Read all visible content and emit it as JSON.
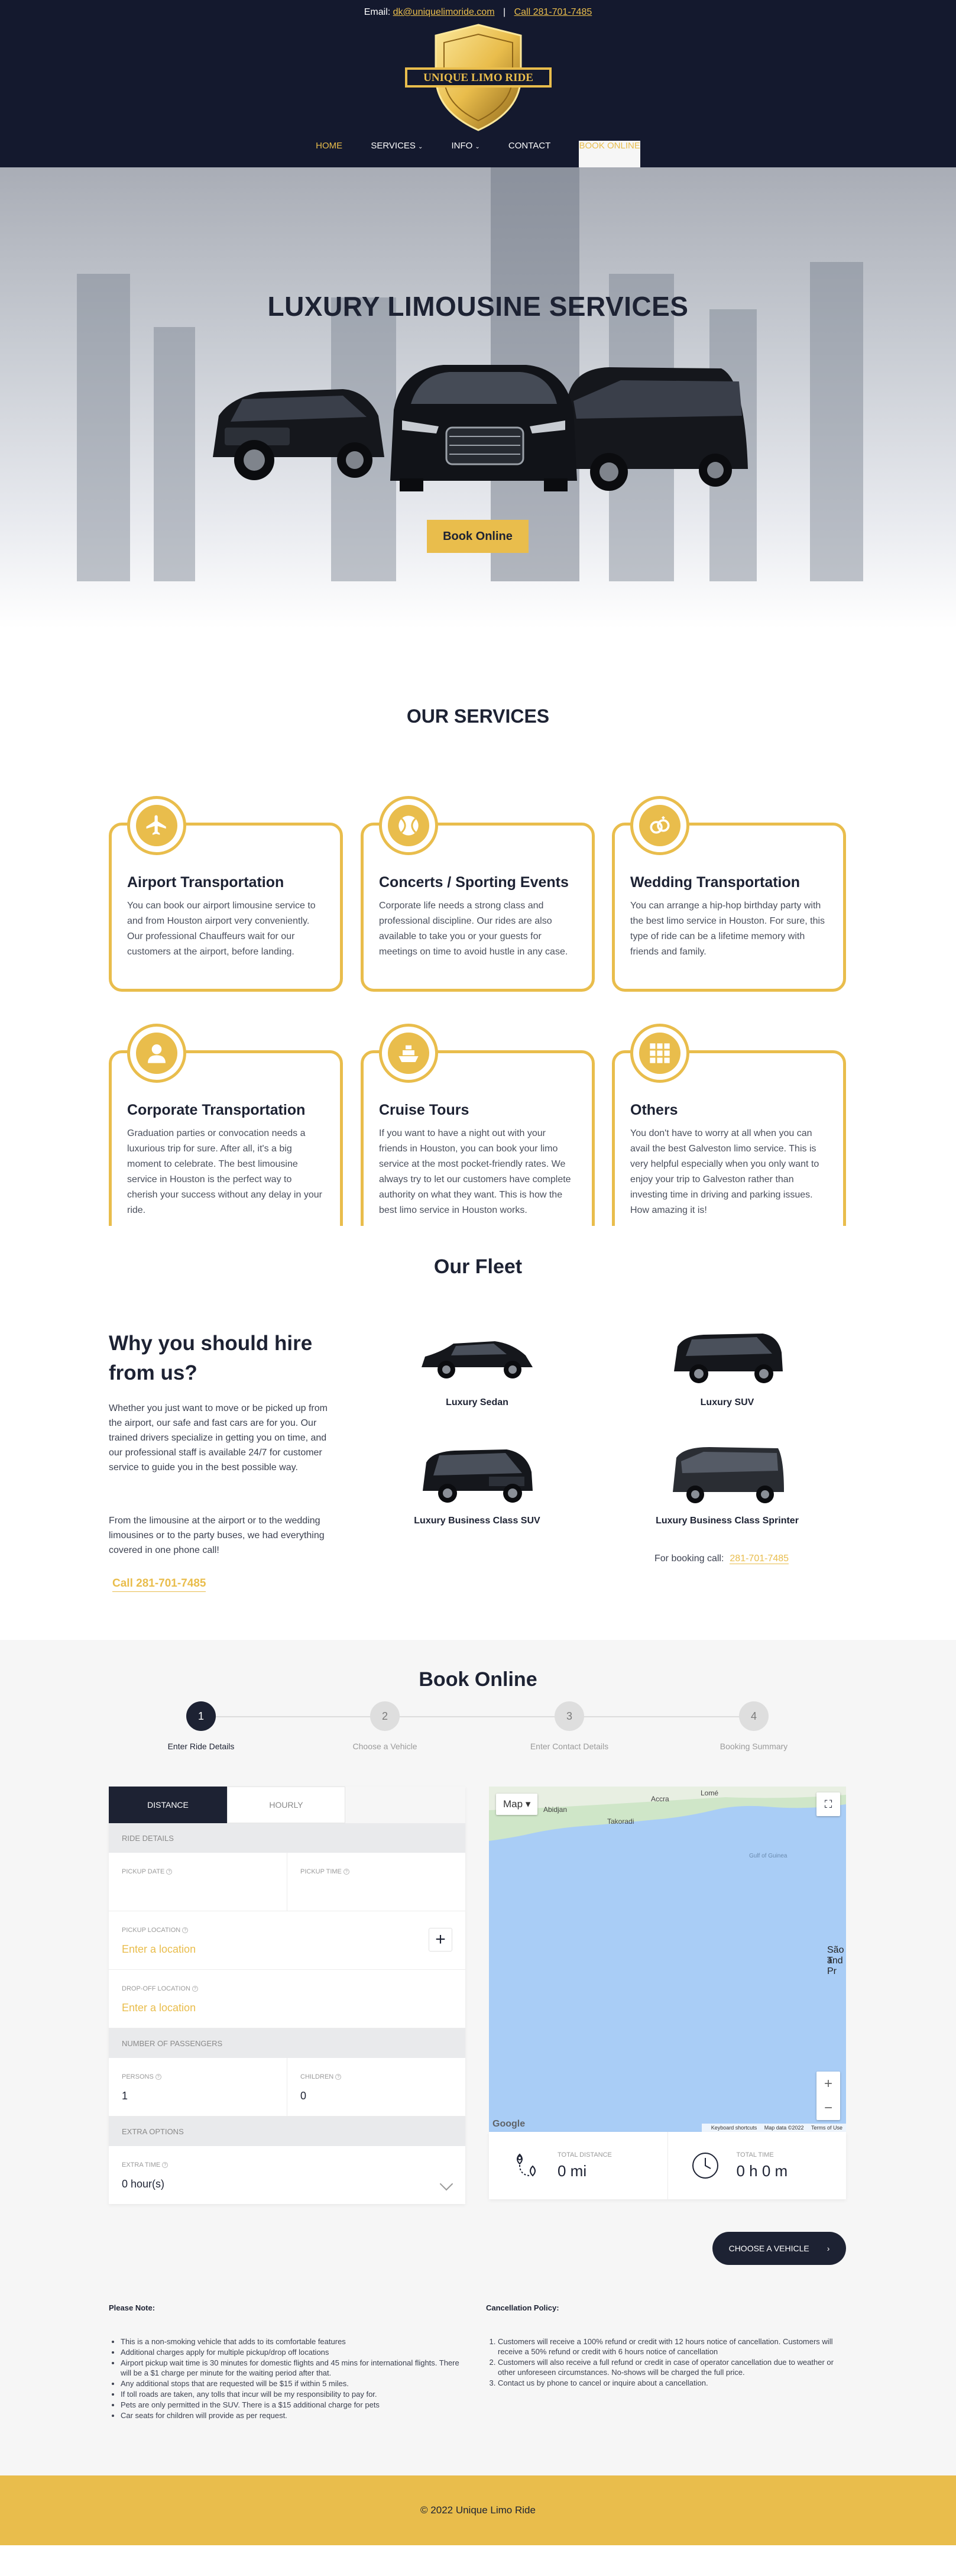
{
  "topbar": {
    "email_label": "Email:",
    "email": "dk@uniquelimoride.com",
    "separator": "|",
    "call": "Call 281-701-7485"
  },
  "logo": {
    "text": "UNIQUE LIMO RIDE"
  },
  "nav": [
    {
      "label": "HOME",
      "dropdown": false
    },
    {
      "label": "SERVICES",
      "dropdown": true
    },
    {
      "label": "INFO",
      "dropdown": true
    },
    {
      "label": "CONTACT",
      "dropdown": false
    },
    {
      "label": "BOOK ONLINE",
      "dropdown": false
    }
  ],
  "hero": {
    "title": "LUXURY LIMOUSINE SERVICES",
    "button": "Book Online"
  },
  "services": {
    "title": "OUR SERVICES",
    "items": [
      {
        "icon": "airplane-icon",
        "title": "Airport Transportation",
        "text": "You can book our airport limousine service to and from Houston airport very conveniently. Our professional Chauffeurs wait for our customers at the airport, before landing."
      },
      {
        "icon": "ball-icon",
        "title": "Concerts / Sporting Events",
        "text": "Corporate life needs a strong class and professional discipline. Our rides are also available to take you or your guests for meetings on time to avoid hustle in any case."
      },
      {
        "icon": "wedding-rings-icon",
        "title": "Wedding Transportation",
        "text": "You can arrange a hip-hop birthday party with the best limo service in Houston. For sure, this type of ride can be a lifetime memory with friends and family."
      },
      {
        "icon": "person-icon",
        "title": "Corporate Transportation",
        "text": "Graduation parties or convocation needs a luxurious trip for sure. After all, it's a big moment to celebrate. The best limousine service in Houston is the perfect way to cherish your success without any delay in your ride."
      },
      {
        "icon": "ship-icon",
        "title": "Cruise Tours",
        "text": "If you want to have a night out with your friends in Houston, you can book your limo service at the most pocket-friendly rates. We always try to let our customers have complete authority on what they want. This is how the best limo service in Houston works."
      },
      {
        "icon": "grid-icon",
        "title": "Others",
        "text": "You don't have to worry at all when you can avail the best Galveston limo service. This is very helpful especially when you only want to enjoy your trip to Galveston rather than investing time in driving and parking issues. How amazing it is!"
      }
    ]
  },
  "fleet": {
    "title": "Our Fleet",
    "why_title": "Why you should hire from us?",
    "why_p1": "Whether you just want to move or be picked up from the airport, our safe and fast cars are for you. Our trained drivers specialize in getting you on time, and our professional staff is available 24/7 for customer service to guide you in the best possible way.",
    "why_p2": "From the limousine at the airport or to the wedding limousines or to the party buses, we had everything covered in one phone call!",
    "call": "Call 281-701-7485",
    "vehicles": [
      {
        "name": "Luxury Sedan"
      },
      {
        "name": "Luxury SUV"
      },
      {
        "name": "Luxury Business Class SUV"
      },
      {
        "name": "Luxury Business Class Sprinter"
      }
    ],
    "booking_label": "For booking call:",
    "booking_phone": "281-701-7485"
  },
  "book": {
    "title": "Book Online",
    "steps": [
      {
        "num": "1",
        "label": "Enter Ride Details"
      },
      {
        "num": "2",
        "label": "Choose a Vehicle"
      },
      {
        "num": "3",
        "label": "Enter Contact Details"
      },
      {
        "num": "4",
        "label": "Booking Summary"
      }
    ],
    "tabs": [
      "DISTANCE",
      "HOURLY"
    ],
    "ride_details": "RIDE DETAILS",
    "pickup_date": "PICKUP DATE",
    "pickup_time": "PICKUP TIME",
    "pickup_location": "PICKUP LOCATION",
    "pickup_placeholder": "Enter a location",
    "dropoff_location": "DROP-OFF LOCATION",
    "dropoff_placeholder": "Enter a location",
    "passengers_section": "NUMBER OF PASSENGERS",
    "persons_label": "PERSONS",
    "persons_value": "1",
    "children_label": "CHILDREN",
    "children_value": "0",
    "extra_section": "EXTRA OPTIONS",
    "extra_time_label": "EXTRA TIME",
    "extra_time_value": "0 hour(s)",
    "map": {
      "type_button": "Map",
      "cities": [
        "Accra",
        "Lomé",
        "Abidjan",
        "Takoradi",
        "Gulf of Guinea",
        "São T",
        "and Pr"
      ],
      "google": "Google",
      "keyboard": "Keyboard shortcuts",
      "map_data": "Map data ©2022",
      "terms": "Terms of Use"
    },
    "total_distance_label": "TOTAL DISTANCE",
    "total_distance_value": "0 mi",
    "total_time_label": "TOTAL TIME",
    "total_time_value": "0 h 0 m",
    "choose_button": "CHOOSE A VEHICLE",
    "note_title": "Please Note:",
    "notes": [
      "This is a non-smoking vehicle that adds to its comfortable features",
      "Additional charges apply for multiple pickup/drop off locations",
      "Airport pickup wait time is 30 minutes for domestic flights and 45 mins for international flights. There will be a $1 charge per minute for the waiting period after that.",
      "Any additional stops that are requested will be $15 if within 5 miles.",
      "If toll roads are taken, any tolls that incur will be my responsibility to pay for.",
      "Pets are only permitted in the SUV. There is a $15 additional charge for pets",
      "Car seats for children will provide as per request."
    ],
    "cancel_title": "Cancellation Policy:",
    "cancel_items": [
      "Customers will receive a 100% refund or credit with 12 hours notice of cancellation. Customers will receive a 50% refund or credit with 6 hours notice of cancellation",
      "Customers will also receive a full refund or credit in case of operator cancellation due to weather or other unforeseen circumstances. No-shows will be charged the full price.",
      "Contact us by phone to cancel or inquire about a cancellation."
    ]
  },
  "footer": {
    "text": "© 2022 Unique Limo Ride"
  },
  "colors": {
    "navy": "#14192e",
    "gold": "#e9bd4c",
    "text": "#1d2233"
  }
}
